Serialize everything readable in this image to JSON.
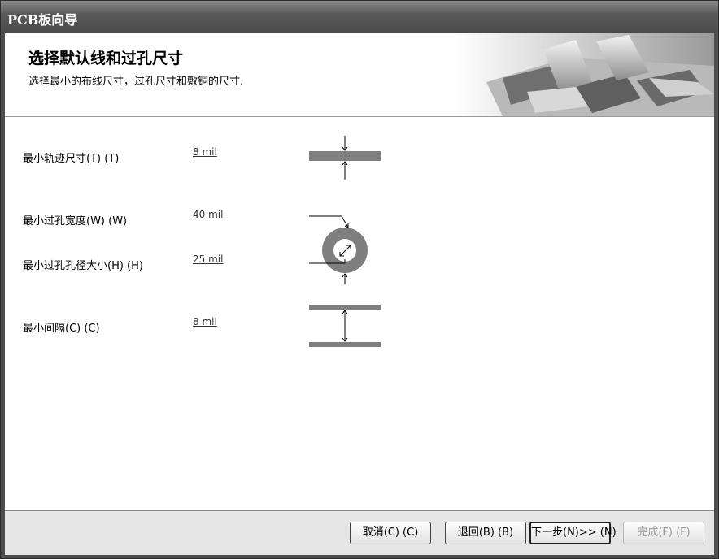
{
  "window": {
    "title": "PCB板向导"
  },
  "header": {
    "title": "选择默认线和过孔尺寸",
    "subtitle": "选择最小的布线尺寸，过孔尺寸和敷铜的尺寸."
  },
  "fields": [
    {
      "label": "最小轨迹尺寸(T) (T)",
      "value": "8 mil"
    },
    {
      "label": "最小过孔宽度(W) (W)",
      "value": "40 mil"
    },
    {
      "label": "最小过孔孔径大小(H) (H)",
      "value": "25 mil"
    },
    {
      "label": "最小间隔(C) (C)",
      "value": "8 mil"
    }
  ],
  "buttons": {
    "cancel": "取消(C) (C)",
    "back": "退回(B) (B)",
    "next": "下一步(N)>> (N)",
    "finish": "完成(F) (F)"
  },
  "colors": {
    "trace": "#7f7f7f",
    "titlebar": "#5a5a5a",
    "footer": "#e6e6e6"
  }
}
